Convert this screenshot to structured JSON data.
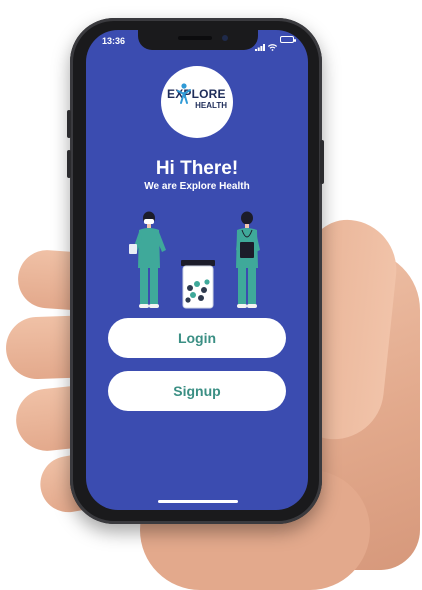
{
  "status_bar": {
    "time": "13:36",
    "icons": [
      "signal-icon",
      "wifi-icon",
      "battery-icon"
    ]
  },
  "logo": {
    "line1": "EXPLORE",
    "line2": "HEALTH"
  },
  "welcome": {
    "title": "Hi There!",
    "subtitle": "We are Explore Health"
  },
  "illustration": {
    "icons": [
      "doctor-with-clipboard-icon",
      "doctor-with-tablet-icon",
      "pill-jar-icon"
    ]
  },
  "buttons": {
    "login_label": "Login",
    "signup_label": "Signup"
  },
  "colors": {
    "background": "#3b4cb0",
    "button_bg": "#ffffff",
    "button_text": "#3b8f84",
    "scrubs": "#3fa99a"
  }
}
